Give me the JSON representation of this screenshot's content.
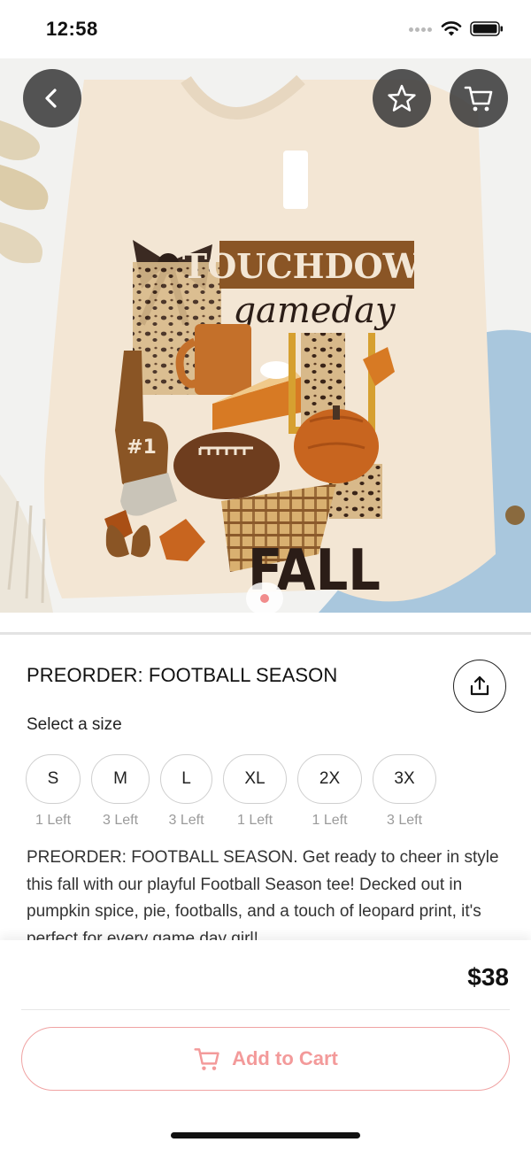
{
  "status_bar": {
    "time": "12:58"
  },
  "hero": {
    "print_text": {
      "line1": "TOUCHDOWN",
      "line2": "gameday",
      "line3": "FALL",
      "badge": "#1"
    },
    "active_page": 1,
    "page_count": 1
  },
  "nav": {
    "back_icon": "chevron-left-icon",
    "favorite_icon": "star-icon",
    "cart_icon": "cart-icon"
  },
  "product": {
    "title": "PREORDER: FOOTBALL SEASON",
    "select_size_label": "Select a size",
    "sizes": [
      {
        "label": "S",
        "stock": "1 Left"
      },
      {
        "label": "M",
        "stock": "3 Left"
      },
      {
        "label": "L",
        "stock": "3 Left"
      },
      {
        "label": "XL",
        "stock": "1 Left"
      },
      {
        "label": "2X",
        "stock": "1 Left"
      },
      {
        "label": "3X",
        "stock": "3 Left"
      }
    ],
    "description": "PREORDER: FOOTBALL SEASON. Get ready to cheer in style this fall with our playful Football Season tee! Decked out in pumpkin spice, pie, footballs, and a touch of leopard print, it's perfect for every game day girl!"
  },
  "checkout": {
    "price": "$38",
    "add_to_cart_label": "Add to Cart"
  },
  "colors": {
    "accent": "#f39a9a",
    "accent_border": "#f0a3a3",
    "pager_active": "#f18c8c",
    "nav_button_bg": "#3c3c3c"
  }
}
